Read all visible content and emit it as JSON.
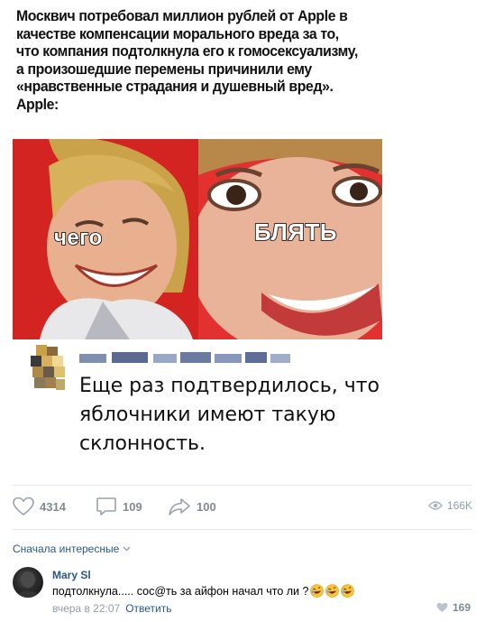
{
  "post": {
    "lines": [
      "Москвич потребовал миллион рублей от Apple в",
      "качестве компенсации морального вреда за то,",
      "что компания подтолкнула его к гомосексуализму,",
      "а произошедшие перемены причинили ему",
      "«нравственные страдания и душевный вред».",
      "Apple:"
    ]
  },
  "meme": {
    "left_caption": "чего",
    "right_caption": "БЛЯТЬ"
  },
  "embedded_comment": {
    "text": "Еще раз подтвердилось, что яблочники имеют такую склонность."
  },
  "actions": {
    "likes": "4314",
    "comments": "109",
    "shares": "100",
    "views": "166K"
  },
  "comments_section": {
    "sort_label": "Сначала интересные"
  },
  "comment": {
    "author": "Mary Sl",
    "text": "подтолкнула..... сос@ть за айфон начал что ли ?",
    "time": "вчера в 22:07",
    "reply_label": "Ответить",
    "likes": "169"
  },
  "colors": {
    "link": "#2a5885",
    "muted": "#828a99",
    "meme_red": "#d42422"
  },
  "icons": [
    "heart-icon",
    "comment-icon",
    "share-icon",
    "eye-icon",
    "chevron-down-icon",
    "rolling-laughing-emoji"
  ]
}
